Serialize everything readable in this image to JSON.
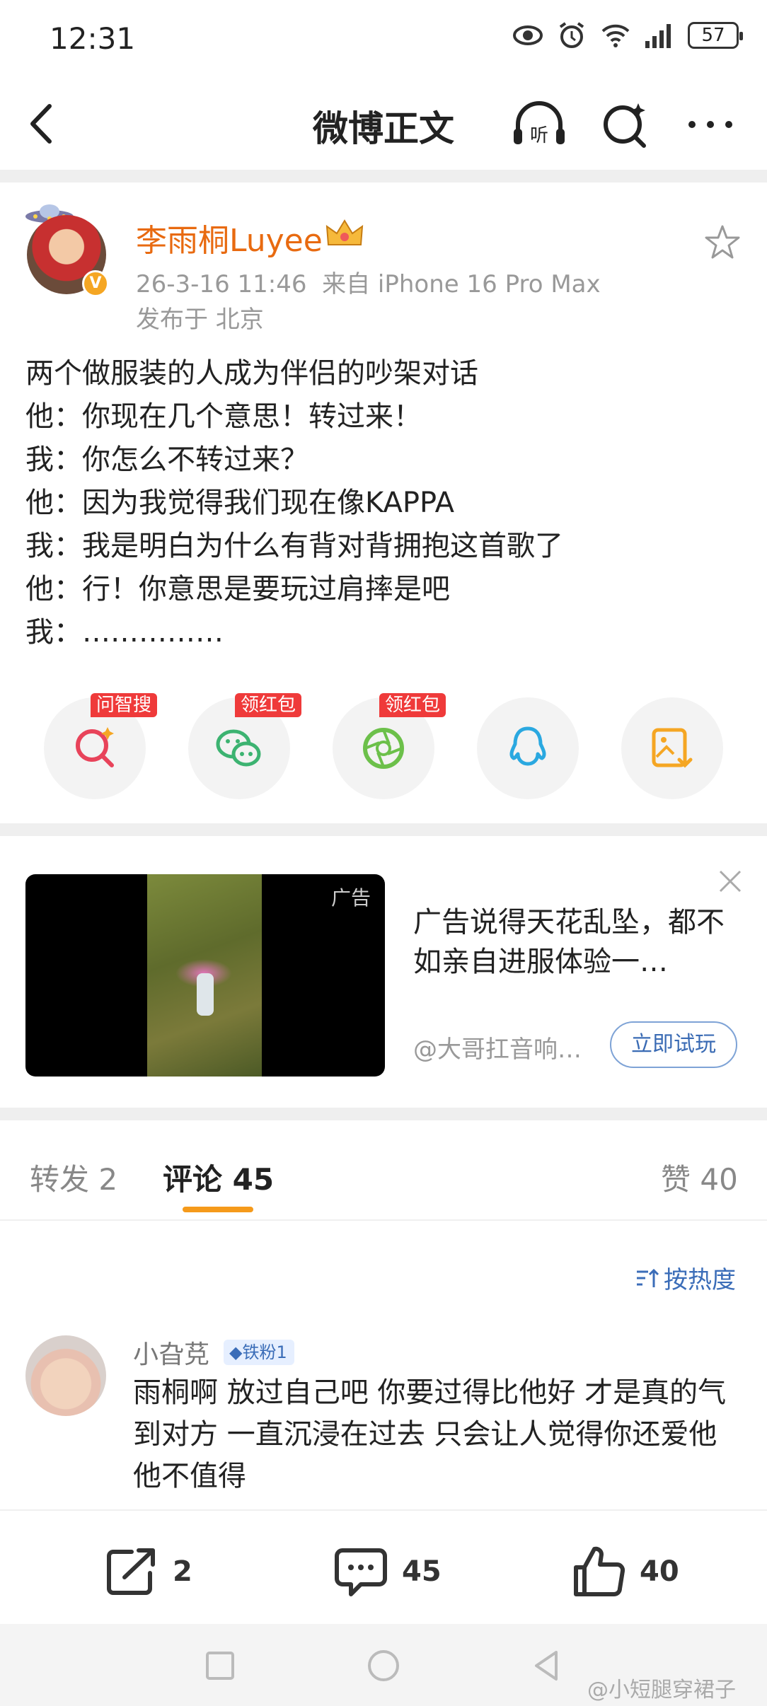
{
  "status_bar": {
    "time": "12:31",
    "battery": "57"
  },
  "nav": {
    "title": "微博正文",
    "listen_label": "听"
  },
  "post": {
    "username": "李雨桐Luyee",
    "timestamp": "26-3-16 11:46",
    "source": "来自 iPhone 16 Pro Max",
    "location": "发布于 北京",
    "lines": [
      "两个做服装的人成为伴侣的吵架对话",
      "他：你现在几个意思！转过来！",
      "我：你怎么不转过来？",
      "他：因为我觉得我们现在像KAPPA",
      "我：我是明白为什么有背对背拥抱这首歌了",
      "他：行！你意思是要玩过肩摔是吧",
      "我：……………"
    ]
  },
  "share_row": {
    "tags": [
      "问智搜",
      "领红包",
      "领红包"
    ]
  },
  "ad": {
    "label": "广告",
    "text": "广告说得天花乱坠，都不如亲自进服体验一…",
    "source": "@大哥扛音响…",
    "cta": "立即试玩"
  },
  "tabs": {
    "repost": "转发 2",
    "comment": "评论 45",
    "like": "赞 40"
  },
  "sort_label": "按热度",
  "comment": {
    "name": "小旮莌",
    "badge": "铁粉1",
    "text": "雨桐啊 放过自己吧 你要过得比他好 才是真的气到对方 一直沉浸在过去 只会让人觉得你还爱他 他不值得"
  },
  "bottom_bar": {
    "repost_count": "2",
    "comment_count": "45",
    "like_count": "40"
  },
  "watermark": "@小短腿穿裙子",
  "colors": {
    "accent_orange": "#f59a1b",
    "username_orange": "#e86a10",
    "link_blue": "#3b6db8",
    "tag_red": "#ef3a3a"
  }
}
